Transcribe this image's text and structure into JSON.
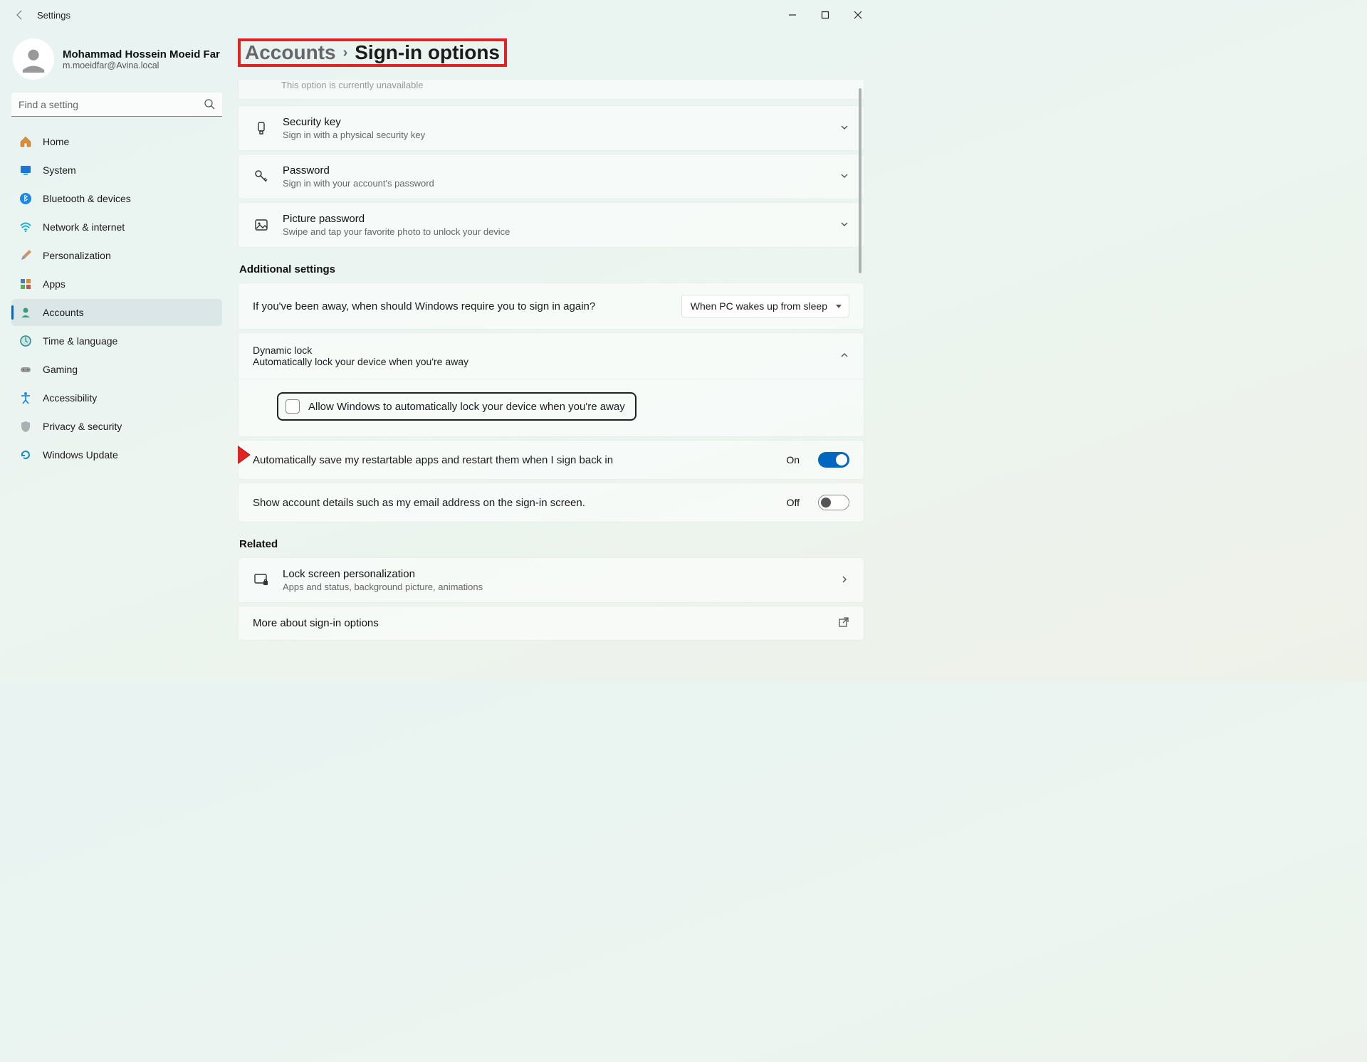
{
  "window": {
    "title": "Settings"
  },
  "user": {
    "name": "Mohammad Hossein Moeid Far",
    "email": "m.moeidfar@Avina.local"
  },
  "search": {
    "placeholder": "Find a setting"
  },
  "nav": {
    "items": [
      {
        "label": "Home"
      },
      {
        "label": "System"
      },
      {
        "label": "Bluetooth & devices"
      },
      {
        "label": "Network & internet"
      },
      {
        "label": "Personalization"
      },
      {
        "label": "Apps"
      },
      {
        "label": "Accounts"
      },
      {
        "label": "Time & language"
      },
      {
        "label": "Gaming"
      },
      {
        "label": "Accessibility"
      },
      {
        "label": "Privacy & security"
      },
      {
        "label": "Windows Update"
      }
    ]
  },
  "breadcrumb": {
    "parent": "Accounts",
    "current": "Sign-in options"
  },
  "clipped": {
    "text": "This option is currently unavailable"
  },
  "signin_options": [
    {
      "title": "Security key",
      "sub": "Sign in with a physical security key"
    },
    {
      "title": "Password",
      "sub": "Sign in with your account's password"
    },
    {
      "title": "Picture password",
      "sub": "Swipe and tap your favorite photo to unlock your device"
    }
  ],
  "additional": {
    "header": "Additional settings",
    "away_label": "If you've been away, when should Windows require you to sign in again?",
    "away_value": "When PC wakes up from sleep",
    "dynamic_lock": {
      "title": "Dynamic lock",
      "sub": "Automatically lock your device when you're away",
      "checkbox_label": "Allow Windows to automatically lock your device when you're away"
    },
    "restart_apps": {
      "label": "Automatically save my restartable apps and restart them when I sign back in",
      "state": "On"
    },
    "show_details": {
      "label": "Show account details such as my email address on the sign-in screen.",
      "state": "Off"
    }
  },
  "related": {
    "header": "Related",
    "items": [
      {
        "title": "Lock screen personalization",
        "sub": "Apps and status, background picture, animations"
      },
      {
        "title": "More about sign-in options"
      }
    ]
  }
}
